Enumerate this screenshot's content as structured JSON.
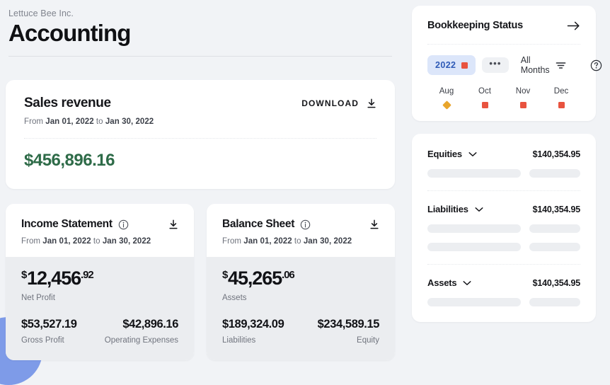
{
  "header": {
    "company": "Lettuce Bee Inc.",
    "title": "Accounting"
  },
  "revenue_card": {
    "title": "Sales revenue",
    "download_label": "DOWNLOAD",
    "range_prefix": "From ",
    "range_start": "Jan 01, 2022",
    "range_mid": " to ",
    "range_end": "Jan 30, 2022",
    "amount": "$456,896.16",
    "amount_color": "#2E6B48"
  },
  "statements": [
    {
      "title": "Income Statement",
      "range_prefix": "From ",
      "range_start": "Jan 01, 2022",
      "range_mid": " to ",
      "range_end": "Jan 30, 2022",
      "currency": "$",
      "primary_whole": "12,456",
      "primary_cents": ".92",
      "primary_caption": "Net Profit",
      "left_value": "$53,527.19",
      "left_caption": "Gross Profit",
      "right_value": "$42,896.16",
      "right_caption": "Operating Expenses"
    },
    {
      "title": "Balance Sheet",
      "range_prefix": "From ",
      "range_start": "Jan 01, 2022",
      "range_mid": " to ",
      "range_end": "Jan 30, 2022",
      "currency": "$",
      "primary_whole": "45,265",
      "primary_cents": ".06",
      "primary_caption": "Assets",
      "left_value": "$189,324.09",
      "left_caption": "Liabilities",
      "right_value": "$234,589.15",
      "right_caption": "Equity"
    }
  ],
  "bookkeeping": {
    "title": "Bookkeeping Status",
    "year": "2022",
    "more_label": "•••",
    "months_filter_label": "All Months",
    "months": [
      {
        "name": "Aug",
        "mark": "diamond",
        "color": "#E8A52B"
      },
      {
        "name": "Oct",
        "mark": "square",
        "color": "#E8533F"
      },
      {
        "name": "Nov",
        "mark": "square",
        "color": "#E8533F"
      },
      {
        "name": "Dec",
        "mark": "square",
        "color": "#E8533F"
      }
    ]
  },
  "accounts": [
    {
      "label": "Equities",
      "amount": "$140,354.95",
      "skeleton_rows": 1
    },
    {
      "label": "Liabilities",
      "amount": "$140,354.95",
      "skeleton_rows": 2
    },
    {
      "label": "Assets",
      "amount": "$140,354.95",
      "skeleton_rows": 1
    }
  ]
}
